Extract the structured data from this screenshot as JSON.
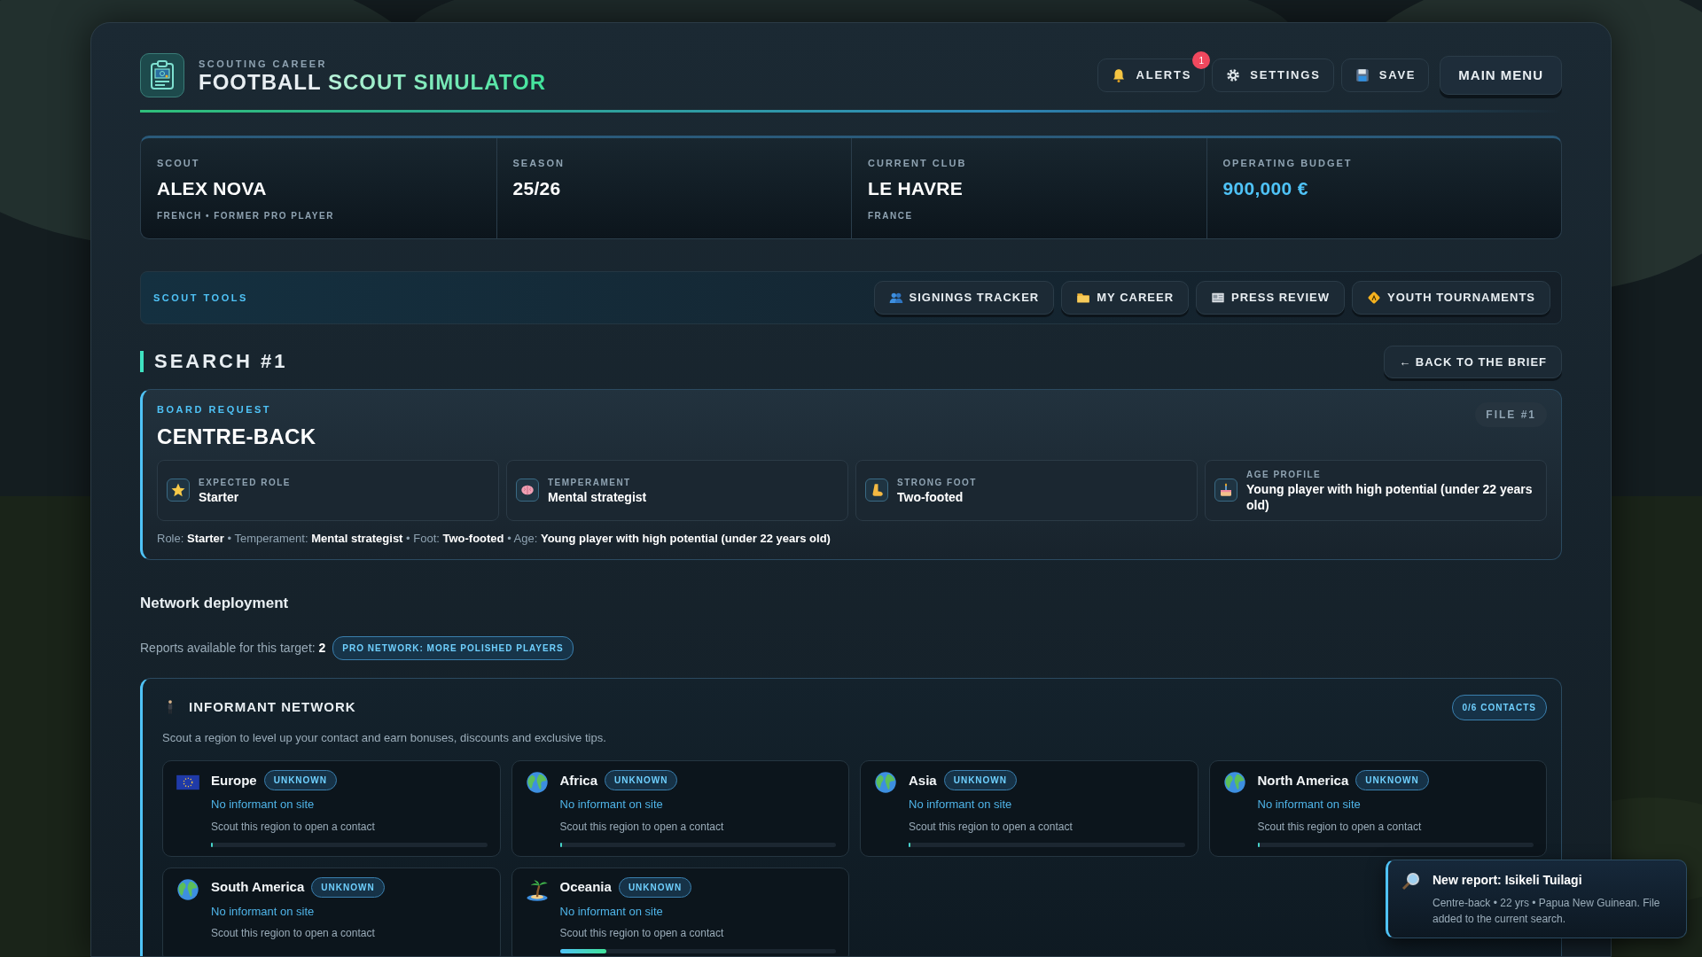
{
  "header": {
    "eyebrow": "SCOUTING CAREER",
    "title": "FOOTBALL",
    "title_accent": "SCOUT SIMULATOR"
  },
  "nav_buttons": [
    {
      "kind": "alerts",
      "label": "ALERTS",
      "badge": "1"
    },
    {
      "kind": "settings",
      "label": "SETTINGS"
    },
    {
      "kind": "save",
      "label": "SAVE"
    },
    {
      "kind": "menu",
      "label": "MAIN MENU"
    }
  ],
  "stats": [
    {
      "label": "SCOUT",
      "value": "ALEX NOVA",
      "sub": "FRENCH • FORMER PRO PLAYER",
      "accent": false
    },
    {
      "label": "SEASON",
      "value": "25/26",
      "accent": false
    },
    {
      "label": "CURRENT CLUB",
      "value": "LE HAVRE",
      "sub": "FRANCE",
      "accent": false
    },
    {
      "label": "OPERATING BUDGET",
      "value": "900,000 €",
      "accent": true
    }
  ],
  "tools": {
    "title": "SCOUT TOOLS",
    "buttons": [
      {
        "kind": "people",
        "label": "SIGNINGS TRACKER"
      },
      {
        "kind": "folder",
        "label": "MY CAREER"
      },
      {
        "kind": "newspaper",
        "label": "PRESS REVIEW"
      },
      {
        "kind": "sign",
        "label": "YOUTH TOURNAMENTS"
      }
    ]
  },
  "search": {
    "title": "SEARCH #1",
    "back_button": "← BACK TO THE BRIEF"
  },
  "brief": {
    "eyebrow": "BOARD REQUEST",
    "title": "CENTRE-BACK",
    "file": "FILE #1",
    "criteria": [
      {
        "kind": "star",
        "label": "EXPECTED ROLE",
        "value": "Starter"
      },
      {
        "kind": "brain",
        "label": "TEMPERAMENT",
        "value": "Mental strategist"
      },
      {
        "kind": "foot",
        "label": "STRONG FOOT",
        "value": "Two-footed"
      },
      {
        "kind": "cake",
        "label": "AGE PROFILE",
        "value": "Young player with high potential (under 22 years old)"
      }
    ],
    "summary": "Role: **Starter** • Temperament: **Mental strategist** • Foot: **Two-footed** • Age: **Young player with high potential (under 22 years old)**"
  },
  "network": {
    "heading": "Network deployment",
    "reports": "Reports available for this target: **2**",
    "tag": "PRO NETWORK: MORE POLISHED PLAYERS"
  },
  "informant": {
    "title": "INFORMANT NETWORK",
    "contacts": "0/6 CONTACTS",
    "description": "Scout a region to level up your contact and earn bonuses, discounts and exclusive tips.",
    "regions": [
      {
        "kind": "flag",
        "name": "Europe",
        "status": "UNKNOWN",
        "informant": "No informant on site",
        "hint": "Scout this region to open a contact",
        "level": 0
      },
      {
        "kind": "globe",
        "name": "Africa",
        "status": "UNKNOWN",
        "informant": "No informant on site",
        "hint": "Scout this region to open a contact",
        "level": 0
      },
      {
        "kind": "globe",
        "name": "Asia",
        "status": "UNKNOWN",
        "informant": "No informant on site",
        "hint": "Scout this region to open a contact",
        "level": 0
      },
      {
        "kind": "globe",
        "name": "North America",
        "status": "UNKNOWN",
        "informant": "No informant on site",
        "hint": "Scout this region to open a contact",
        "level": 0
      },
      {
        "kind": "globe",
        "name": "South America",
        "status": "UNKNOWN",
        "informant": "No informant on site",
        "hint": "Scout this region to open a contact"
      },
      {
        "kind": "island",
        "name": "Oceania",
        "status": "UNKNOWN",
        "informant": "No informant on site",
        "hint": "Scout this region to open a contact",
        "level": 0.17
      }
    ]
  },
  "toast": {
    "title": "New report: Isikeli Tuilagi",
    "text": "Centre-back • 22 yrs • Papua New Guinean. File added to the current search."
  }
}
